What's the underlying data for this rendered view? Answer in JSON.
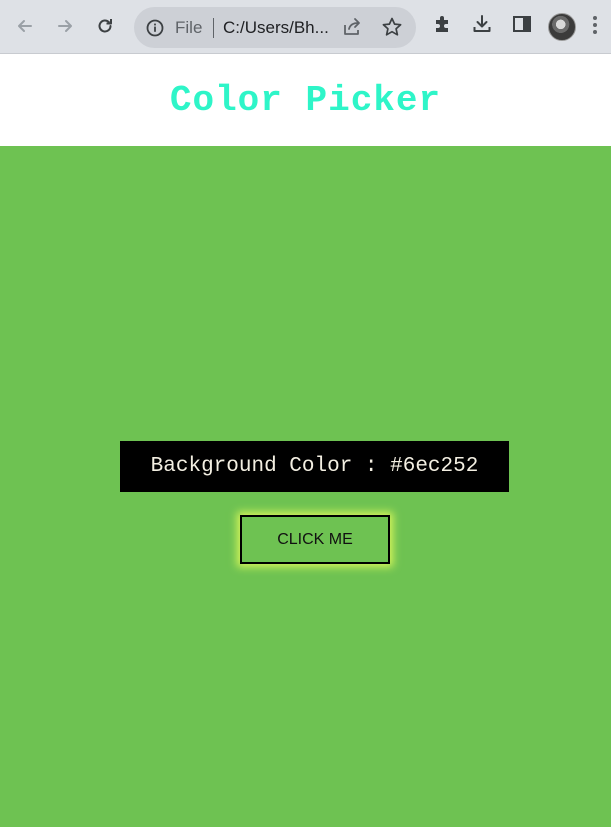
{
  "browser": {
    "omnibox": {
      "scheme_label": "File",
      "url": "C:/Users/Bh..."
    },
    "icons": {
      "back": "back-arrow-icon",
      "forward": "forward-arrow-icon",
      "reload": "reload-icon",
      "info": "info-icon",
      "share": "share-icon",
      "star": "bookmark-star-icon",
      "extensions": "puzzle-icon",
      "download": "download-icon",
      "side_panel": "side-panel-icon",
      "profile": "avatar",
      "menu": "kebab-menu-icon"
    }
  },
  "page": {
    "title": "Color Picker",
    "background_label": "Background Color",
    "background_value": "#6ec252",
    "background_text": "Background Color : #6ec252",
    "button_label": "CLICK ME"
  },
  "colors": {
    "title": "#2ef5c8",
    "page_background": "#6ec252",
    "label_box": "#000000",
    "label_text": "#f3efe2",
    "button_glow": "#d6f55a"
  }
}
